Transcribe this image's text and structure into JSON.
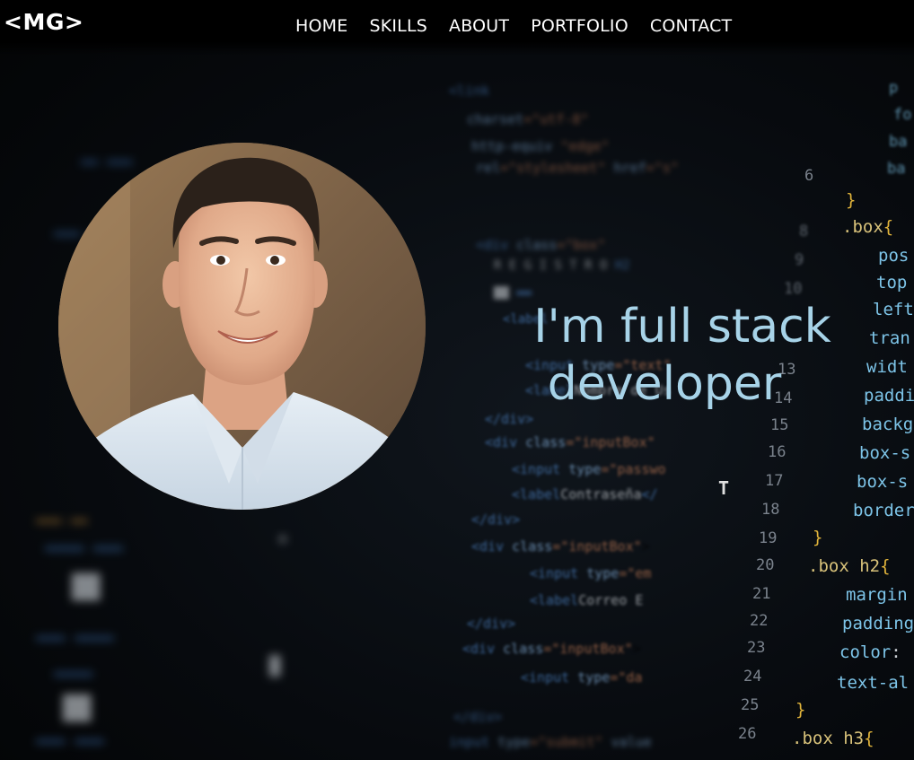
{
  "nav": {
    "logo": "<MG>",
    "links": [
      "HOME",
      "SKILLS",
      "ABOUT",
      "PORTFOLIO",
      "CONTACT"
    ]
  },
  "hero": {
    "headline_line1": "I'm full stack",
    "headline_line2": "developer"
  },
  "colors": {
    "background": "#070a0e",
    "nav_text": "#ffffff",
    "headline": "#a7d3e8"
  }
}
